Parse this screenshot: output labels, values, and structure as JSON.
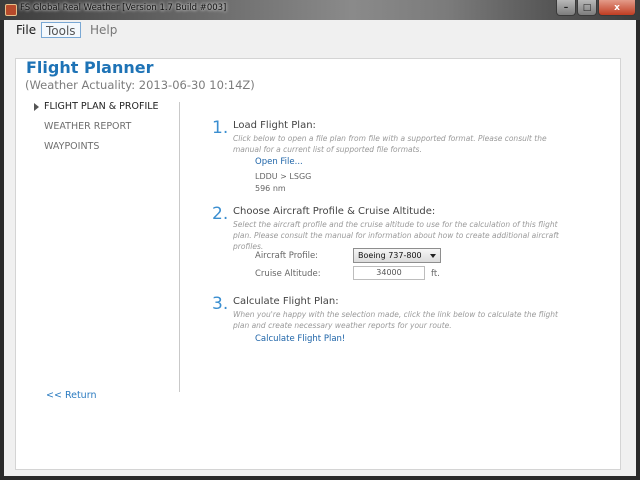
{
  "window": {
    "title": "FS Global Real Weather [Version 1.7 Build #003]",
    "icon": "app-icon",
    "caption_buttons": {
      "minimize": "–",
      "maximize": "□",
      "close": "x"
    }
  },
  "menu": {
    "file": "File",
    "tools": "Tools",
    "help": "Help"
  },
  "page": {
    "title": "Flight Planner",
    "subtitle": "(Weather Actuality: 2013-06-30 10:14Z)"
  },
  "nav": {
    "items": [
      {
        "label": "FLIGHT PLAN & PROFILE",
        "selected": true
      },
      {
        "label": "WEATHER REPORT",
        "selected": false
      },
      {
        "label": "WAYPOINTS",
        "selected": false
      }
    ]
  },
  "steps": {
    "load": {
      "number": "1.",
      "title": "Load Flight Plan:",
      "description": "Click below to open a file plan from file with a supported format. Please consult the manual for a current list of supported file formats.",
      "link": "Open File...",
      "route": "LDDU > LSGG",
      "distance": "596 nm"
    },
    "aircraft": {
      "number": "2.",
      "title": "Choose Aircraft Profile & Cruise Altitude:",
      "description": "Select the aircraft profile and the cruise altitude to use for the calculation of this flight plan. Please consult the manual for information about how to create additional aircraft profiles.",
      "profile_label": "Aircraft Profile:",
      "profile_value": "Boeing 737-800",
      "altitude_label": "Cruise Altitude:",
      "altitude_value": "34000",
      "altitude_unit": "ft."
    },
    "calculate": {
      "number": "3.",
      "title": "Calculate Flight Plan:",
      "description": "When you're happy with the selection made, click the link below to calculate the flight plan and create necessary weather reports for your route.",
      "link": "Calculate Flight Plan!"
    }
  },
  "footer": {
    "return_link": "<< Return"
  },
  "colors": {
    "accent": "#1e73b6",
    "link": "#1e64a8",
    "close_button": "#c13d22"
  }
}
